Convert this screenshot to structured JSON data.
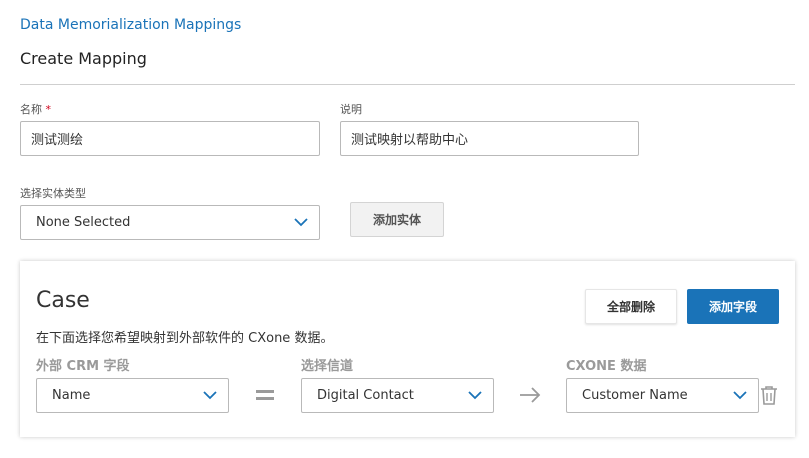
{
  "breadcrumb": "Data Memorialization Mappings",
  "page_title": "Create Mapping",
  "form": {
    "name_label": "名称",
    "required_mark": "*",
    "name_value": "测试测绘",
    "desc_label": "说明",
    "desc_value": "测试映射以帮助中心",
    "entity_type_label": "选择实体类型",
    "entity_type_value": "None Selected",
    "add_entity_button": "添加实体"
  },
  "card": {
    "title": "Case",
    "description": "在下面选择您希望映射到外部软件的 CXone 数据。",
    "delete_all_button": "全部删除",
    "add_field_button": "添加字段",
    "columns": {
      "external_crm": "外部 CRM 字段",
      "channel": "选择信道",
      "cxone": "CXONE 数据"
    },
    "row": {
      "external_crm_value": "Name",
      "channel_value": "Digital Contact",
      "cxone_value": "Customer Name"
    }
  },
  "colors": {
    "accent": "#1a73b8",
    "required": "#d0021b"
  }
}
